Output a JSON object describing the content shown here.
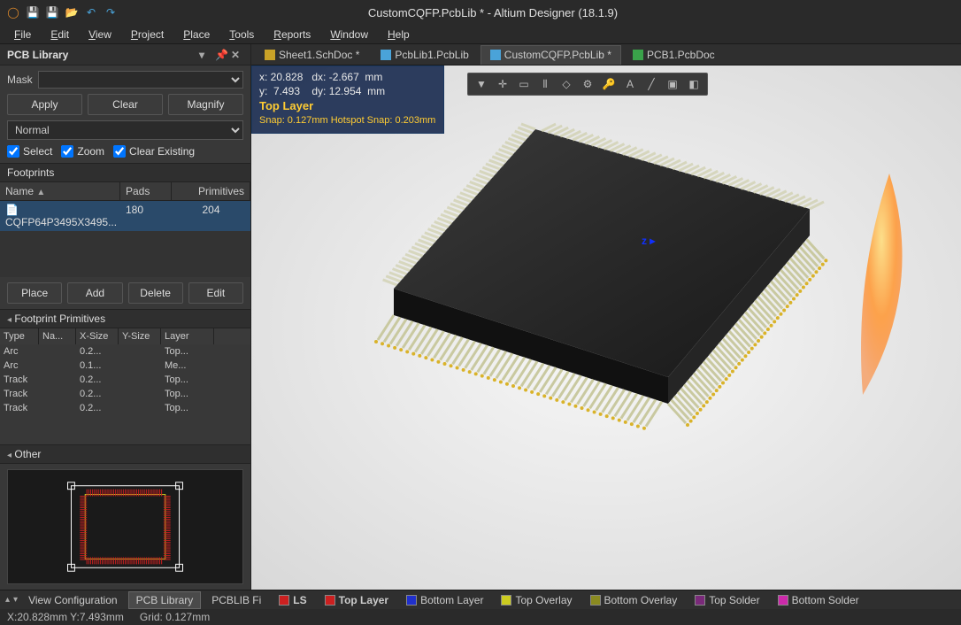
{
  "title": "CustomCQFP.PcbLib * - Altium Designer (18.1.9)",
  "menu": [
    "File",
    "Edit",
    "View",
    "Project",
    "Place",
    "Tools",
    "Reports",
    "Window",
    "Help"
  ],
  "panel": {
    "title": "PCB Library",
    "mask_label": "Mask",
    "apply": "Apply",
    "clear": "Clear",
    "magnify": "Magnify",
    "normal": "Normal",
    "select": "Select",
    "zoom": "Zoom",
    "clear_existing": "Clear Existing",
    "footprints_header": "Footprints",
    "col_name": "Name",
    "col_pads": "Pads",
    "col_prims": "Primitives",
    "footprints": [
      {
        "name": "CQFP64P3495X3495...",
        "pads": "180",
        "prims": "204"
      }
    ],
    "place": "Place",
    "add": "Add",
    "delete": "Delete",
    "edit": "Edit",
    "fp_prim_header": "Footprint Primitives",
    "pcol_type": "Type",
    "pcol_name": "Na...",
    "pcol_xsize": "X-Size",
    "pcol_ysize": "Y-Size",
    "pcol_layer": "Layer",
    "primitives": [
      {
        "type": "Arc",
        "name": "",
        "xsize": "0.2...",
        "ysize": "",
        "layer": "Top..."
      },
      {
        "type": "Arc",
        "name": "",
        "xsize": "0.1...",
        "ysize": "",
        "layer": "Me..."
      },
      {
        "type": "Track",
        "name": "",
        "xsize": "0.2...",
        "ysize": "",
        "layer": "Top..."
      },
      {
        "type": "Track",
        "name": "",
        "xsize": "0.2...",
        "ysize": "",
        "layer": "Top..."
      },
      {
        "type": "Track",
        "name": "",
        "xsize": "0.2...",
        "ysize": "",
        "layer": "Top..."
      }
    ],
    "other_header": "Other"
  },
  "tabs": [
    {
      "label": "Sheet1.SchDoc *",
      "icon": "#c9a227",
      "active": false
    },
    {
      "label": "PcbLib1.PcbLib",
      "icon": "#4aa3d9",
      "active": false
    },
    {
      "label": "CustomCQFP.PcbLib *",
      "icon": "#4aa3d9",
      "active": true
    },
    {
      "label": "PCB1.PcbDoc",
      "icon": "#3aa24a",
      "active": false
    }
  ],
  "coords": {
    "line1": "x: 20.828   dx: -2.667  mm",
    "line2": "y:  7.493    dy: 12.954  mm",
    "layer": "Top Layer",
    "snap": "Snap: 0.127mm Hotspot Snap: 0.203mm"
  },
  "bottom_tabs": {
    "view_config": "View Configuration",
    "pcb_library": "PCB Library",
    "pcblib_fi": "PCBLIB Fi",
    "layers": [
      {
        "label": "LS",
        "color": "#cc2020",
        "bold": true
      },
      {
        "label": "Top Layer",
        "color": "#cc2020",
        "bold": true
      },
      {
        "label": "Bottom Layer",
        "color": "#2030cc",
        "bold": false
      },
      {
        "label": "Top Overlay",
        "color": "#cccc20",
        "bold": false
      },
      {
        "label": "Bottom Overlay",
        "color": "#8a8a20",
        "bold": false
      },
      {
        "label": "Top Solder",
        "color": "#7a2a7a",
        "bold": false
      },
      {
        "label": "Bottom Solder",
        "color": "#cc2aaa",
        "bold": false
      }
    ]
  },
  "status": {
    "xy": "X:20.828mm Y:7.493mm",
    "grid": "Grid: 0.127mm"
  }
}
